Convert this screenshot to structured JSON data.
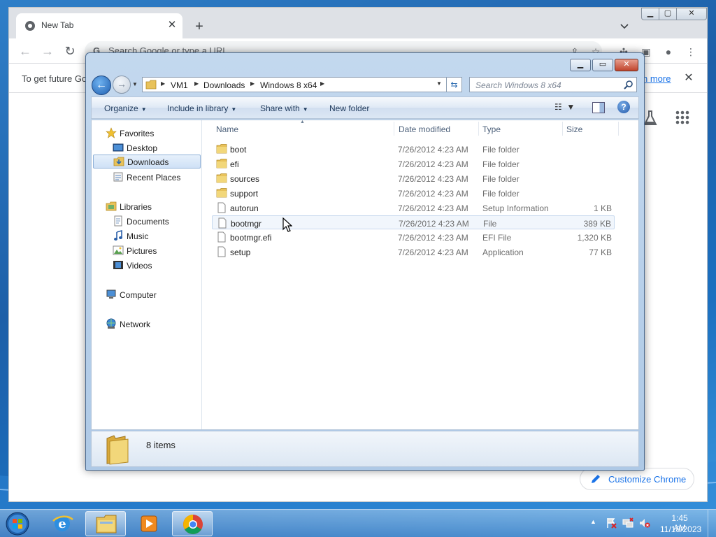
{
  "chrome": {
    "tab_title": "New Tab",
    "tab_close": "✕",
    "new_tab": "+",
    "omnibox_placeholder": "Search Google or type a URL",
    "infobar_text": "To get future Go",
    "infobar_link": "n more",
    "infobar_close": "✕",
    "customize_label": "Customize Chrome"
  },
  "explorer": {
    "breadcrumbs": [
      "VM1",
      "Downloads",
      "Windows 8 x64"
    ],
    "search_placeholder": "Search Windows 8 x64",
    "commands": {
      "organize": "Organize",
      "include": "Include in library",
      "share": "Share with",
      "new_folder": "New folder"
    },
    "nav": {
      "favorites": "Favorites",
      "desktop": "Desktop",
      "downloads": "Downloads",
      "recent": "Recent Places",
      "libraries": "Libraries",
      "documents": "Documents",
      "music": "Music",
      "pictures": "Pictures",
      "videos": "Videos",
      "computer": "Computer",
      "network": "Network"
    },
    "columns": {
      "name": "Name",
      "date": "Date modified",
      "type": "Type",
      "size": "Size"
    },
    "files": [
      {
        "name": "boot",
        "date": "7/26/2012 4:23 AM",
        "type": "File folder",
        "size": "",
        "icon": "folder-icon"
      },
      {
        "name": "efi",
        "date": "7/26/2012 4:23 AM",
        "type": "File folder",
        "size": "",
        "icon": "folder-icon"
      },
      {
        "name": "sources",
        "date": "7/26/2012 4:23 AM",
        "type": "File folder",
        "size": "",
        "icon": "folder-icon"
      },
      {
        "name": "support",
        "date": "7/26/2012 4:23 AM",
        "type": "File folder",
        "size": "",
        "icon": "folder-icon"
      },
      {
        "name": "autorun",
        "date": "7/26/2012 4:23 AM",
        "type": "Setup Information",
        "size": "1 KB",
        "icon": "file-icon"
      },
      {
        "name": "bootmgr",
        "date": "7/26/2012 4:23 AM",
        "type": "File",
        "size": "389 KB",
        "icon": "file-icon"
      },
      {
        "name": "bootmgr.efi",
        "date": "7/26/2012 4:23 AM",
        "type": "EFI File",
        "size": "1,320 KB",
        "icon": "file-icon"
      },
      {
        "name": "setup",
        "date": "7/26/2012 4:23 AM",
        "type": "Application",
        "size": "77 KB",
        "icon": "file-icon"
      }
    ],
    "details_count": "8 items"
  },
  "taskbar": {
    "time": "1:45 AM",
    "date": "11/18/2023"
  },
  "colors": {
    "chrome_link": "#1a73e8",
    "explorer_frame": "#c3d8ee",
    "folder": "#e8c25a"
  }
}
